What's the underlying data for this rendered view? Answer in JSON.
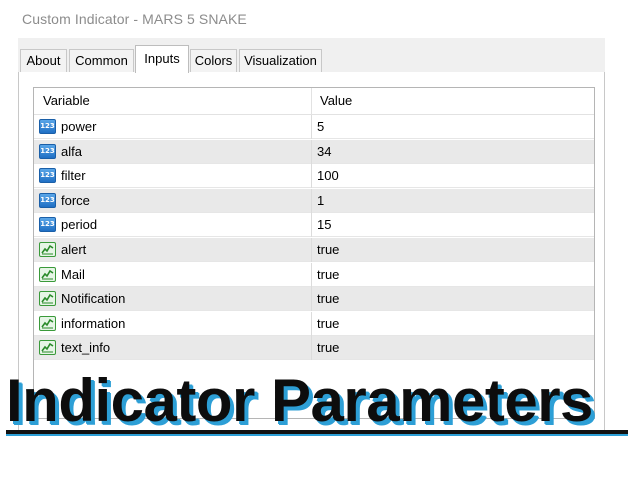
{
  "window": {
    "title": "Custom Indicator - MARS 5 SNAKE"
  },
  "tabs": [
    {
      "label": "About",
      "active": false
    },
    {
      "label": "Common",
      "active": false
    },
    {
      "label": "Inputs",
      "active": true
    },
    {
      "label": "Colors",
      "active": false
    },
    {
      "label": "Visualization",
      "active": false
    }
  ],
  "grid": {
    "headers": {
      "variable": "Variable",
      "value": "Value"
    },
    "number_icon_text": "123",
    "rows": [
      {
        "name": "power",
        "value": "5",
        "icon": "number-icon"
      },
      {
        "name": "alfa",
        "value": "34",
        "icon": "number-icon"
      },
      {
        "name": "filter",
        "value": "100",
        "icon": "number-icon"
      },
      {
        "name": "force",
        "value": "1",
        "icon": "number-icon"
      },
      {
        "name": "period",
        "value": "15",
        "icon": "number-icon"
      },
      {
        "name": "alert",
        "value": "true",
        "icon": "boolean-icon"
      },
      {
        "name": "Mail",
        "value": "true",
        "icon": "boolean-icon"
      },
      {
        "name": "Notification",
        "value": "true",
        "icon": "boolean-icon"
      },
      {
        "name": "information",
        "value": "true",
        "icon": "boolean-icon"
      },
      {
        "name": "text_info",
        "value": "true",
        "icon": "boolean-icon"
      }
    ]
  },
  "banner": {
    "text": "Indicator Parameters"
  },
  "colors": {
    "accent": "#2d9fd6",
    "row_alt": "#e9e9e9"
  }
}
